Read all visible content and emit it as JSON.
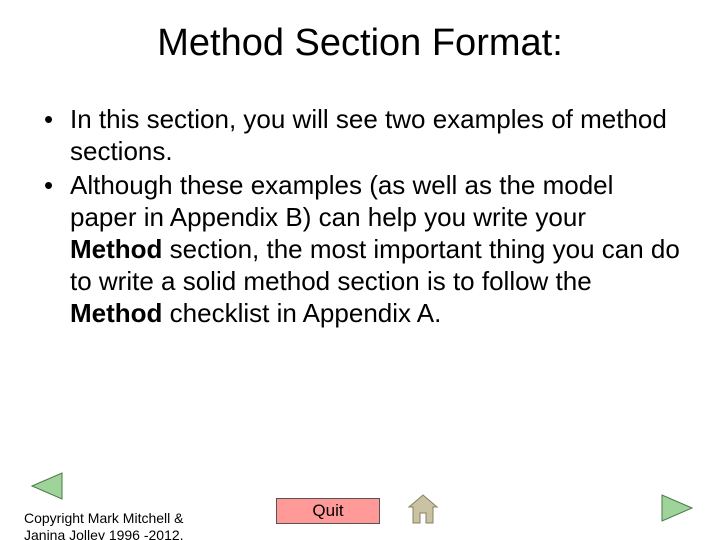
{
  "title": "Method Section Format:",
  "bullets": [
    {
      "dot": "•",
      "html": " In this section, you will see two examples of method sections."
    },
    {
      "dot": "•",
      "html": " Although these examples (as well as the model paper in Appendix B) can help you write your <b>Method</b> section, the most important thing you can do to write a solid method section is to follow the <b>Method</b> checklist in Appendix A."
    }
  ],
  "copyright_line1": "Copyright Mark Mitchell &",
  "copyright_line2": "Janina Jolley 1996 -2012.",
  "quit_label": "Quit"
}
